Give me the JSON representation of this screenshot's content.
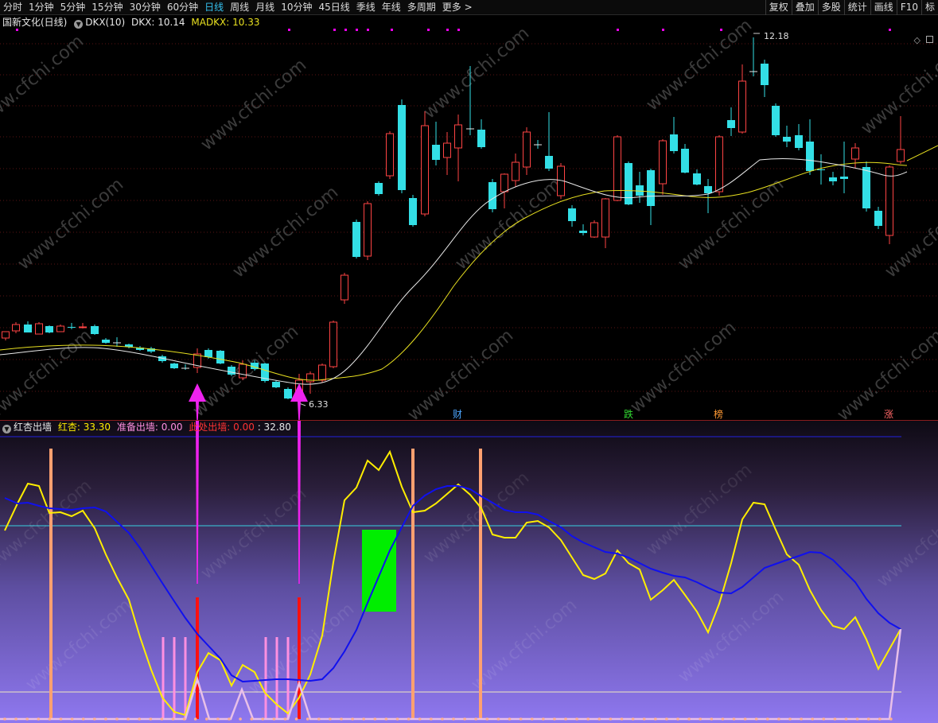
{
  "toolbar": {
    "periods": [
      "分时",
      "1分钟",
      "5分钟",
      "15分钟",
      "30分钟",
      "60分钟",
      "日线",
      "周线",
      "月线",
      "10分钟",
      "45日线",
      "季线",
      "年线",
      "多周期",
      "更多 >"
    ],
    "active_period": "日线",
    "right_tools": [
      "复权",
      "叠加",
      "多股",
      "统计",
      "画线",
      "F10",
      "标"
    ]
  },
  "main_chart": {
    "title": "国新文化(日线)",
    "indicator_name": "DKX(10)",
    "dkx_label": "DKX: 10.14",
    "madkx_label": "MADKX: 10.33",
    "high_label": "12.18",
    "low_label": "6.33",
    "event_tags": [
      {
        "text": "财",
        "color": "#4da6ff"
      },
      {
        "text": "跌",
        "color": "#33dd33"
      },
      {
        "text": "榜",
        "color": "#ff9933"
      },
      {
        "text": "涨",
        "color": "#ff6666"
      }
    ],
    "colors": {
      "up": "#ff4444",
      "down": "#33dfe6",
      "dkx": "#e8e8e8",
      "madkx": "#e8e020",
      "signal_dots": "#ee00ee",
      "arrow": "#ee22ee"
    },
    "watermark": "www.cfchi.com"
  },
  "sub_chart": {
    "indicator_name": "红杏出墙",
    "hongxing_label": "红杏: 33.30",
    "prepare_label": "准备出墙: 0.00",
    "here_label": "此处出墙: 0.00",
    "extra_value": ": 32.80",
    "colors": {
      "yellow": "#ffee00",
      "blue": "#1010ee",
      "cyan": "#38d0e0",
      "orange": "#ffa070",
      "pink": "#ff90e0",
      "red": "#ff1010",
      "green": "#00ee00"
    }
  }
}
